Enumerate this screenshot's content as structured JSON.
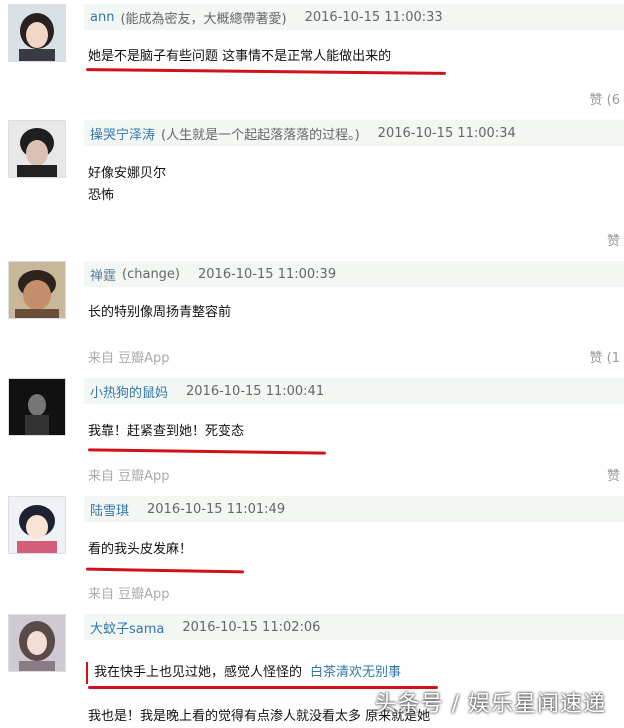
{
  "comments": [
    {
      "author": "ann",
      "signature": "(能成為密友，大概總帶著愛)",
      "time": "2016-10-15 11:00:33",
      "lines": [
        "她是不是脑子有些问题 这事情不是正常人能做出来的"
      ],
      "source": "",
      "like": "赞 (6"
    },
    {
      "author": "操哭宁泽涛",
      "signature": "(人生就是一个起起落落落的过程。)",
      "time": "2016-10-15 11:00:34",
      "lines": [
        "好像安娜贝尔",
        "恐怖"
      ],
      "source": "",
      "like": "赞"
    },
    {
      "author": "禅霆",
      "signature": "(change)",
      "time": "2016-10-15 11:00:39",
      "lines": [
        "长的特别像周扬青整容前"
      ],
      "source": "来自 豆瓣App",
      "like": "赞 (1"
    },
    {
      "author": "小热狗的鼠妈",
      "signature": "",
      "time": "2016-10-15 11:00:41",
      "lines": [
        "我靠！赶紧查到她！死变态"
      ],
      "source": "来自 豆瓣App",
      "like": "赞"
    },
    {
      "author": "陆雪琪",
      "signature": "",
      "time": "2016-10-15 11:01:49",
      "lines": [
        "看的我头皮发麻！"
      ],
      "source": "来自 豆瓣App",
      "like": ""
    },
    {
      "author": "大蚊子sama",
      "signature": "",
      "time": "2016-10-15 11:02:06",
      "quote": "我在快手上也见过她，感觉人怪怪的",
      "quote_tag": "白茶清欢无别事",
      "lines": [
        "我也是！我是晚上看的觉得有点渗人就没看太多 原来就是她"
      ],
      "source": "",
      "like": ""
    }
  ],
  "watermark": "头条号 / 娱乐星闻速递",
  "colors": {
    "accent": "#d0131b",
    "author": "#3377aa",
    "header_bg": "#f2f7f3"
  }
}
